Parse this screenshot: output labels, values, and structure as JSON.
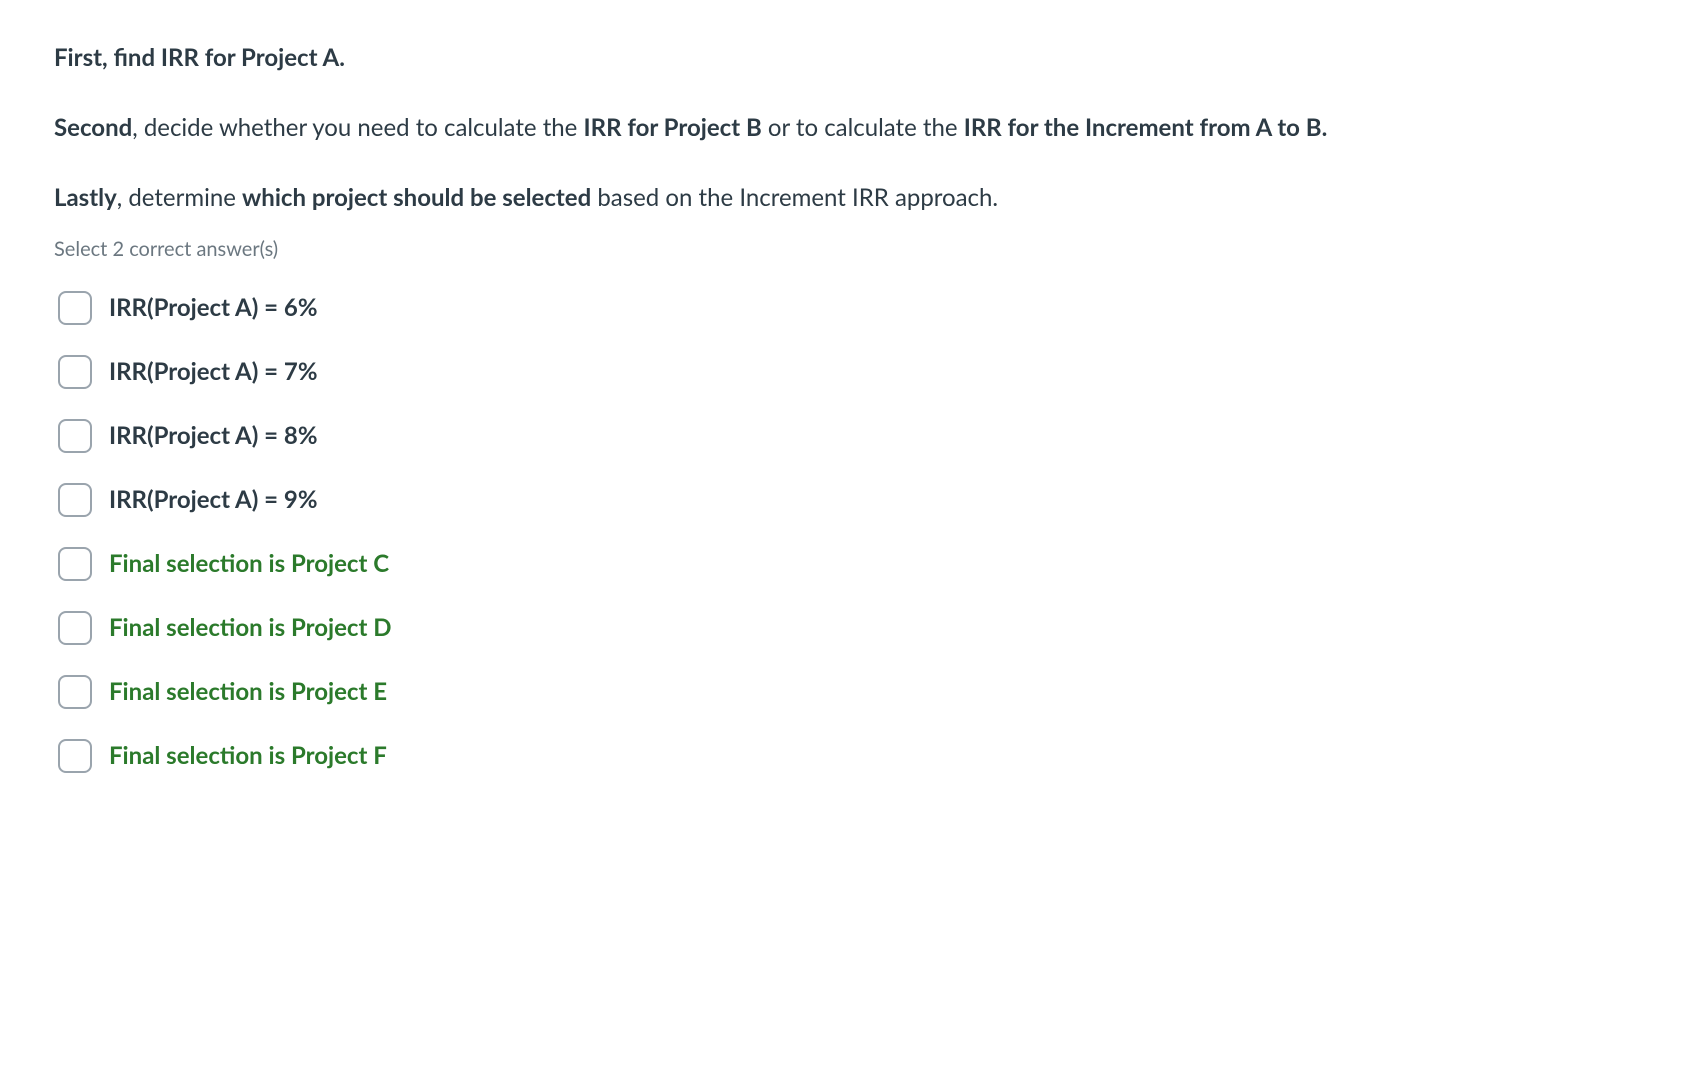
{
  "question": {
    "para1": {
      "bold1": "First, find IRR for Project A."
    },
    "para2": {
      "bold1": "Second",
      "text1": ", decide whether you need to calculate the ",
      "bold2": "IRR for Project B",
      "text2": " or to calculate the ",
      "bold3": "IRR for the Increment from A to B."
    },
    "para3": {
      "bold1": "Lastly",
      "text1": ", determine ",
      "bold2": "which project should be selected",
      "text2": " based on the Increment IRR approach."
    }
  },
  "hint": "Select 2 correct answer(s)",
  "choices": [
    {
      "label": "IRR(Project A) = 6%",
      "style": "black"
    },
    {
      "label": "IRR(Project A) = 7%",
      "style": "black"
    },
    {
      "label": "IRR(Project A) = 8%",
      "style": "black"
    },
    {
      "label": "IRR(Project A) = 9%",
      "style": "black"
    },
    {
      "label": "Final selection is Project C",
      "style": "green"
    },
    {
      "label": "Final selection is Project D",
      "style": "green"
    },
    {
      "label": "Final selection is Project E",
      "style": "green"
    },
    {
      "label": "Final selection is Project F",
      "style": "green"
    }
  ]
}
